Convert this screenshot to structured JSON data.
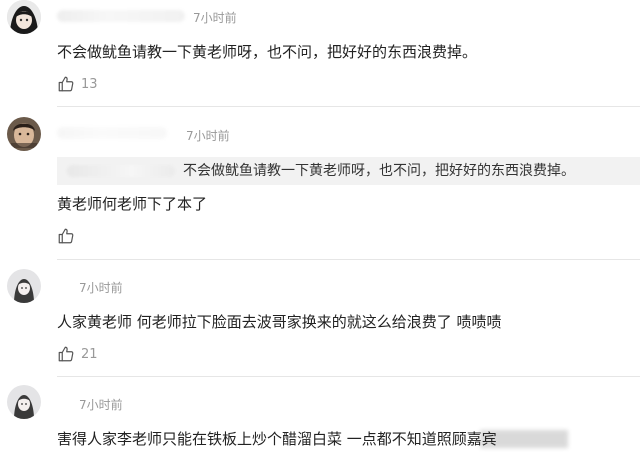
{
  "comments": [
    {
      "time": "7小时前",
      "text": "不会做鱿鱼请教一下黄老师呀，也不问，把好好的东西浪费掉。",
      "likes": "13"
    },
    {
      "time": "7小时前",
      "quoted_text": "不会做鱿鱼请教一下黄老师呀，也不问，把好好的东西浪费掉。",
      "text": "黄老师何老师下了本了",
      "likes": ""
    },
    {
      "time": "7小时前",
      "text": "人家黄老师 何老师拉下脸面去波哥家换来的就这么给浪费了 啧啧啧",
      "likes": "21"
    },
    {
      "time": "7小时前",
      "text": "害得人家李老师只能在铁板上炒个醋溜白菜 一点都不知道照顾嘉宾"
    }
  ],
  "icons": {
    "like": "thumbs-up-icon"
  },
  "colors": {
    "text": "#222222",
    "meta": "#999999",
    "quote_bg": "#f2f2f2",
    "divider": "#e6e6e6"
  }
}
